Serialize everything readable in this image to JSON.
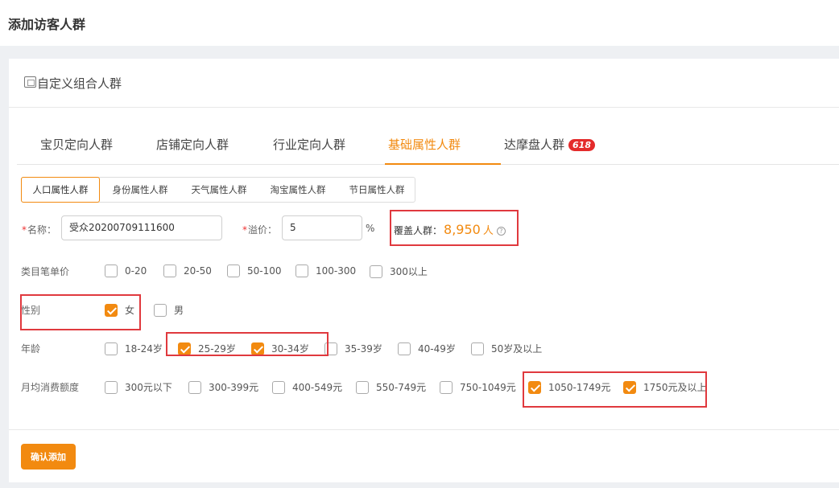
{
  "page_title": "添加访客人群",
  "panel": {
    "title": "自定义组合人群"
  },
  "tabs": [
    {
      "label": "宝贝定向人群",
      "active": false
    },
    {
      "label": "店铺定向人群",
      "active": false
    },
    {
      "label": "行业定向人群",
      "active": false
    },
    {
      "label": "基础属性人群",
      "active": true
    },
    {
      "label": "达摩盘人群",
      "badge": "618",
      "active": false
    }
  ],
  "subtabs": [
    {
      "label": "人口属性人群",
      "active": true
    },
    {
      "label": "身份属性人群",
      "active": false
    },
    {
      "label": "天气属性人群",
      "active": false
    },
    {
      "label": "淘宝属性人群",
      "active": false
    },
    {
      "label": "节日属性人群",
      "active": false
    }
  ],
  "form": {
    "name_label": "名称：",
    "name_value": "受众20200709111600",
    "premium_label": "溢价：",
    "premium_value": "5",
    "percent_sign": "%",
    "required_mark": "*",
    "coverage_label": "覆盖人群：",
    "coverage_value": "8,950",
    "coverage_unit": "人",
    "help_glyph": "?"
  },
  "filters": {
    "category_price": {
      "label": "类目笔单价",
      "options": [
        {
          "label": "0-20",
          "checked": false
        },
        {
          "label": "20-50",
          "checked": false
        },
        {
          "label": "50-100",
          "checked": false
        },
        {
          "label": "100-300",
          "checked": false
        },
        {
          "label": "300以上",
          "checked": false
        }
      ]
    },
    "gender": {
      "label": "性别",
      "options": [
        {
          "label": "女",
          "checked": true
        },
        {
          "label": "男",
          "checked": false
        }
      ]
    },
    "age": {
      "label": "年龄",
      "options": [
        {
          "label": "18-24岁",
          "checked": false
        },
        {
          "label": "25-29岁",
          "checked": true
        },
        {
          "label": "30-34岁",
          "checked": true
        },
        {
          "label": "35-39岁",
          "checked": false
        },
        {
          "label": "40-49岁",
          "checked": false
        },
        {
          "label": "50岁及以上",
          "checked": false
        }
      ]
    },
    "monthly_spend": {
      "label": "月均消费额度",
      "options": [
        {
          "label": "300元以下",
          "checked": false
        },
        {
          "label": "300-399元",
          "checked": false
        },
        {
          "label": "400-549元",
          "checked": false
        },
        {
          "label": "550-749元",
          "checked": false
        },
        {
          "label": "750-1049元",
          "checked": false
        },
        {
          "label": "1050-1749元",
          "checked": true
        },
        {
          "label": "1750元及以上",
          "checked": true
        }
      ]
    }
  },
  "confirm_button": "确认添加",
  "colors": {
    "accent": "#f28a10",
    "highlight": "#e0393e",
    "badge": "#e42b2b"
  },
  "icons": {
    "panel": "panel-icon",
    "help": "help-icon",
    "check": "checkmark-icon"
  }
}
